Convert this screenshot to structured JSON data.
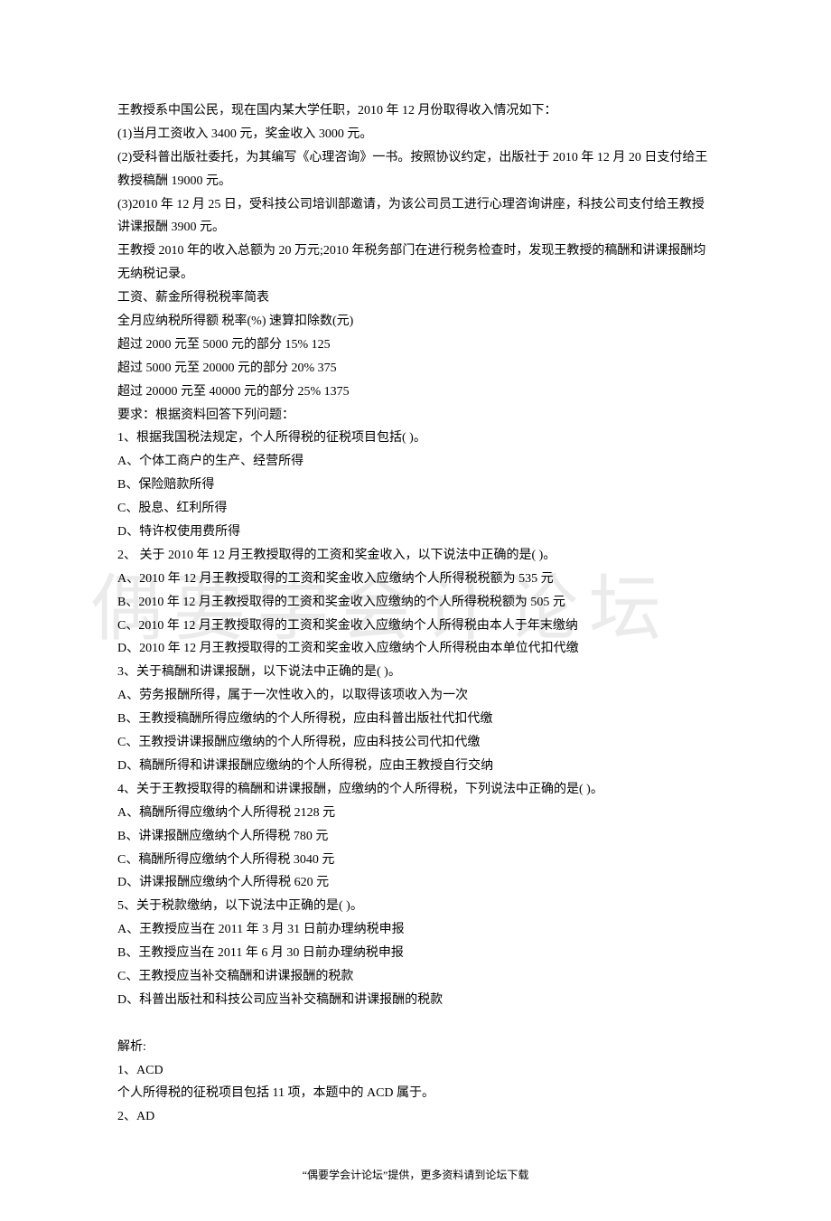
{
  "watermark": "偶要学会计论坛",
  "intro": [
    "王教授系中国公民，现在国内某大学任职，2010 年 12 月份取得收入情况如下：",
    "(1)当月工资收入 3400 元，奖金收入 3000 元。",
    "(2)受科普出版社委托，为其编写《心理咨询》一书。按照协议约定，出版社于 2010 年 12 月 20 日支付给王教授稿酬 19000 元。",
    "(3)2010 年 12 月 25 日，受科技公司培训部邀请，为该公司员工进行心理咨询讲座，科技公司支付给王教授讲课报酬 3900 元。",
    "王教授 2010 年的收入总额为 20 万元;2010 年税务部门在进行税务检查时，发现王教授的稿酬和讲课报酬均无纳税记录。",
    "工资、薪金所得税税率简表",
    "全月应纳税所得额  税率(%)  速算扣除数(元)",
    "超过 2000 元至 5000 元的部分  15% 125",
    "超过 5000 元至 20000 元的部分  20% 375",
    "超过 20000 元至 40000 元的部分  25% 1375",
    "要求：根据资料回答下列问题："
  ],
  "questions": [
    {
      "stem": "1、根据我国税法规定，个人所得税的征税项目包括( )。",
      "options": [
        "A、个体工商户的生产、经营所得",
        "B、保险赔款所得",
        "C、股息、红利所得",
        "D、特许权使用费所得"
      ]
    },
    {
      "stem": "2、 关于 2010 年 12 月王教授取得的工资和奖金收入，以下说法中正确的是( )。",
      "options": [
        "A、2010 年 12 月王教授取得的工资和奖金收入应缴纳个人所得税税额为 535 元",
        "B、2010 年 12 月王教授取得的工资和奖金收入应缴纳的个人所得税税额为 505 元",
        "C、2010 年 12 月王教授取得的工资和奖金收入应缴纳个人所得税由本人于年末缴纳",
        "D、2010 年 12 月王教授取得的工资和奖金收入应缴纳个人所得税由本单位代扣代缴"
      ]
    },
    {
      "stem": "3、关于稿酬和讲课报酬，以下说法中正确的是( )。",
      "options": [
        "A、劳务报酬所得，属于一次性收入的，以取得该项收入为一次",
        "B、王教授稿酬所得应缴纳的个人所得税，应由科普出版社代扣代缴",
        "C、王教授讲课报酬应缴纳的个人所得税，应由科技公司代扣代缴",
        "D、稿酬所得和讲课报酬应缴纳的个人所得税，应由王教授自行交纳"
      ]
    },
    {
      "stem": "4、关于王教授取得的稿酬和讲课报酬，应缴纳的个人所得税，下列说法中正确的是( )。",
      "options": [
        "A、稿酬所得应缴纳个人所得税 2128 元",
        "B、讲课报酬应缴纳个人所得税 780 元",
        "C、稿酬所得应缴纳个人所得税 3040 元",
        "D、讲课报酬应缴纳个人所得税 620 元"
      ]
    },
    {
      "stem": "5、关于税款缴纳，以下说法中正确的是( )。",
      "options": [
        "A、王教授应当在 2011 年 3 月 31 日前办理纳税申报",
        "B、王教授应当在 2011 年 6 月 30 日前办理纳税申报",
        "C、王教授应当补交稿酬和讲课报酬的税款",
        "D、科普出版社和科技公司应当补交稿酬和讲课报酬的税款"
      ]
    }
  ],
  "analysis_heading": "解析:",
  "analysis": [
    "1、ACD",
    "个人所得税的征税项目包括 11 项，本题中的 ACD 属于。",
    "2、AD"
  ],
  "footer": "“偶要学会计论坛”提供，更多资料请到论坛下载"
}
